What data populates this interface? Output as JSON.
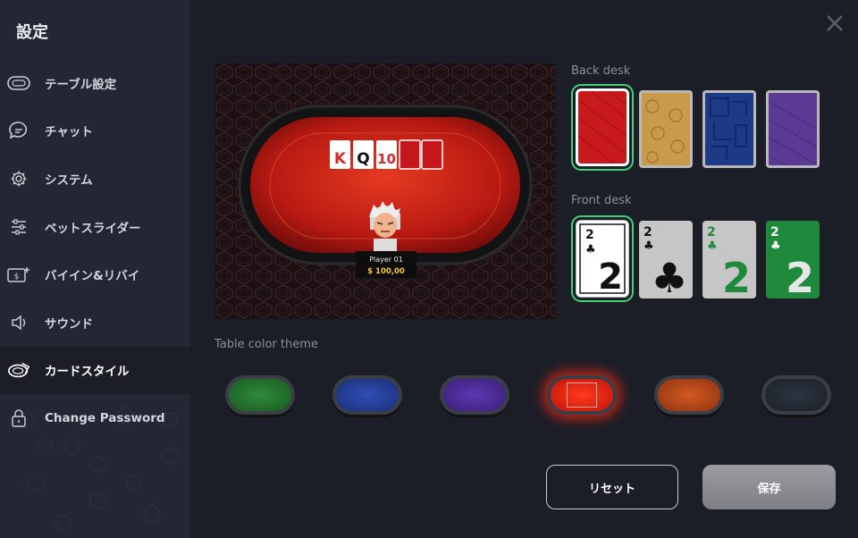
{
  "sidebar": {
    "title": "設定",
    "items": [
      {
        "label": "テーブル設定",
        "icon": "table-icon"
      },
      {
        "label": "チャット",
        "icon": "chat-icon"
      },
      {
        "label": "システム",
        "icon": "gear-icon"
      },
      {
        "label": "ベットスライダー",
        "icon": "slider-icon"
      },
      {
        "label": "バイイン&リバイ",
        "icon": "buyin-icon"
      },
      {
        "label": "サウンド",
        "icon": "speaker-icon"
      },
      {
        "label": "カードスタイル",
        "icon": "card-style-icon",
        "active": true
      },
      {
        "label": "Change Password",
        "icon": "lock-icon"
      }
    ]
  },
  "preview": {
    "player_name": "Player 01",
    "player_stack": "$ 100,00",
    "community_cards": [
      {
        "rank": "K",
        "color": "#d32b2b"
      },
      {
        "rank": "Q",
        "color": "#111111"
      },
      {
        "rank": "10",
        "color": "#d32b2b"
      }
    ]
  },
  "back_desk": {
    "label": "Back desk",
    "options": [
      {
        "name": "red",
        "color": "#c8191d",
        "selected": true
      },
      {
        "name": "gold",
        "color": "#c99a4a"
      },
      {
        "name": "blue",
        "color": "#1d3a86"
      },
      {
        "name": "purple",
        "color": "#5b3a93"
      }
    ]
  },
  "front_desk": {
    "label": "Front desk",
    "options": [
      {
        "name": "classic-white",
        "rank": "2",
        "selected": true
      },
      {
        "name": "grey",
        "rank": "2"
      },
      {
        "name": "grey-green",
        "rank": "2"
      },
      {
        "name": "green",
        "rank": "2"
      }
    ]
  },
  "table_theme": {
    "label": "Table color theme",
    "options": [
      {
        "name": "green",
        "color": "#1f6a2a"
      },
      {
        "name": "blue",
        "color": "#223c93"
      },
      {
        "name": "purple",
        "color": "#4a2a8f"
      },
      {
        "name": "red",
        "color": "#d11b12",
        "selected": true
      },
      {
        "name": "orange",
        "color": "#b2441b"
      },
      {
        "name": "dark",
        "color": "#262c36"
      }
    ]
  },
  "buttons": {
    "reset_label": "リセット",
    "save_label": "保存"
  }
}
